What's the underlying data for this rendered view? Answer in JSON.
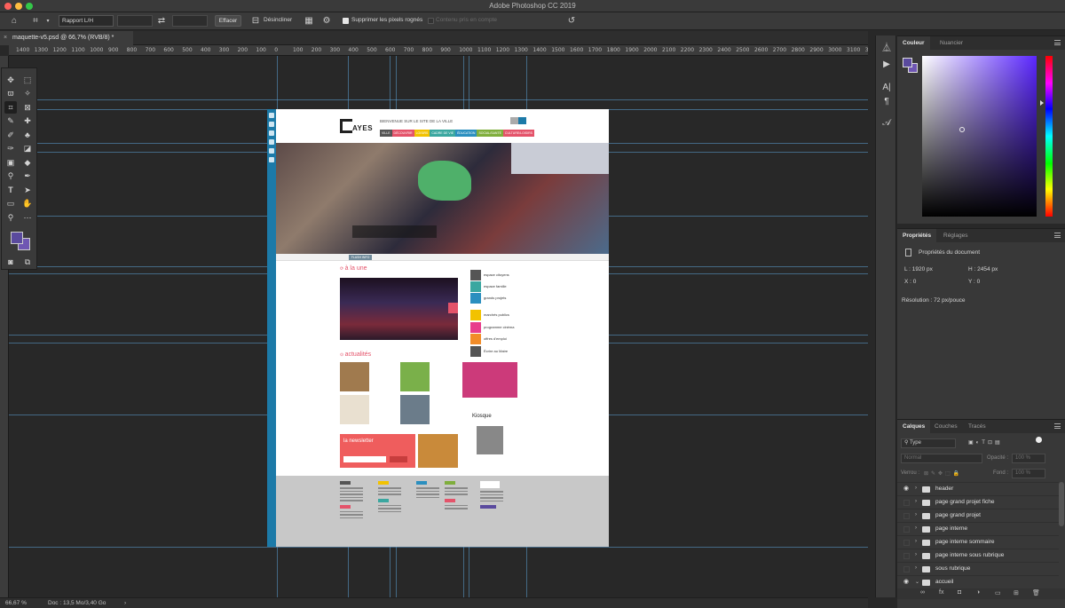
{
  "window": {
    "title": "Adobe Photoshop CC 2019"
  },
  "options_bar": {
    "ratio_select": "Rapport L/H",
    "clear_button": "Effacer",
    "straighten_label": "Désincliner",
    "delete_pixels_label": "Supprimer les pixels rognés",
    "content_aware_label": "Contenu pris en compte"
  },
  "document": {
    "tab_label": "maquette-v5.psd @ 66,7% (RVB/8) *"
  },
  "ruler": {
    "labels": [
      "1400",
      "1300",
      "1200",
      "1100",
      "1000",
      "900",
      "800",
      "700",
      "600",
      "500",
      "400",
      "300",
      "200",
      "100",
      "0",
      "100",
      "200",
      "300",
      "400",
      "500",
      "600",
      "700",
      "800",
      "900",
      "1000",
      "1100",
      "1200",
      "1300",
      "1400",
      "1500",
      "1600",
      "1700",
      "1800",
      "1900",
      "2000",
      "2100",
      "2200",
      "2300",
      "2400",
      "2500",
      "2600",
      "2700",
      "2800",
      "2900",
      "3000",
      "3100",
      "3200",
      "330"
    ]
  },
  "mockup": {
    "logo": "AYES",
    "welcome": "BIENVENUE SUR LE SITE DE LA VILLE",
    "menu": [
      {
        "label": "VILLE",
        "color": "#555555"
      },
      {
        "label": "DÉCOUVRIR",
        "color": "#e4536a"
      },
      {
        "label": "LOISIRS",
        "color": "#f2c200"
      },
      {
        "label": "CADRE DE VIE",
        "color": "#3aa7a0"
      },
      {
        "label": "ÉDUCATION",
        "color": "#2b8fbf"
      },
      {
        "label": "SOCIAL/SANTÉ",
        "color": "#7fae3c"
      },
      {
        "label": "CULTURE/LOISIRS",
        "color": "#e4536a"
      }
    ],
    "flash_tag": "FLASH INFO",
    "une_title": "à la une",
    "actu_title": "actualités",
    "newsletter_title": "la newsletter",
    "newsletter_button": "",
    "kiosque_title": "Kiosque",
    "quick_links": [
      {
        "label": "espace citoyens",
        "color": "#555555"
      },
      {
        "label": "espace famille",
        "color": "#3aa7a0"
      },
      {
        "label": "grands projets",
        "color": "#2b8fbf"
      },
      {
        "label": "marchés publics",
        "color": "#f2c200"
      },
      {
        "label": "programme cinéma",
        "color": "#e83e8c"
      },
      {
        "label": "offres d'emploi",
        "color": "#f28c28"
      },
      {
        "label": "Écrire au Maire",
        "color": "#555555"
      }
    ]
  },
  "statusbar": {
    "zoom": "66,67 %",
    "doc": "Doc : 13,5 Mo/3,40 Go"
  },
  "color_panel": {
    "tabs": [
      "Couleur",
      "Nuancier"
    ],
    "fg": "#5a4a9e",
    "bg": "#6f56b3"
  },
  "properties_panel": {
    "tabs": [
      "Propriétés",
      "Réglages"
    ],
    "doc_label": "Propriétés du document",
    "width": "L : 1920 px",
    "height": "H : 2454 px",
    "x": "X : 0",
    "y": "Y : 0",
    "resolution": "Résolution : 72 px/pouce"
  },
  "layers_panel": {
    "tabs": [
      "Calques",
      "Couches",
      "Tracés"
    ],
    "filter": "Type",
    "blend": "Normal",
    "opacity_label": "Opacité :",
    "opacity_value": "100 %",
    "lock_label": "Verrou :",
    "fill_label": "Fond :",
    "fill_value": "100 %",
    "layers": [
      {
        "name": "header",
        "visible": true,
        "open": false
      },
      {
        "name": "page grand projet fiche",
        "visible": false,
        "open": false
      },
      {
        "name": "page grand projet",
        "visible": false,
        "open": false
      },
      {
        "name": "page interne",
        "visible": false,
        "open": false
      },
      {
        "name": "page interne sommaire",
        "visible": false,
        "open": false
      },
      {
        "name": "page interne sous rubrique",
        "visible": false,
        "open": false
      },
      {
        "name": "sous rubrique",
        "visible": false,
        "open": false
      },
      {
        "name": "accueil",
        "visible": true,
        "open": true
      }
    ]
  }
}
